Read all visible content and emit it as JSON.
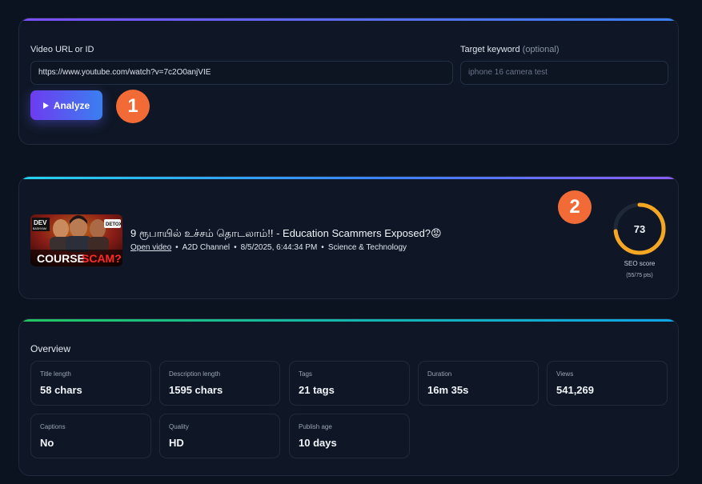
{
  "analyze_form": {
    "video_label": "Video URL or ID",
    "video_value": "https://www.youtube.com/watch?v=7c2O0anjVIE",
    "keyword_label": "Target keyword",
    "keyword_optional": "(optional)",
    "keyword_placeholder": "iphone 16 camera test",
    "analyze_button": "Analyze"
  },
  "markers": {
    "one": "1",
    "two": "2"
  },
  "video": {
    "title": "9 ரூபாயில் உச்சம் தொடலாம்!! - Education Scammers Exposed?😡",
    "open_link": "Open video",
    "channel": "A2D Channel",
    "published": "8/5/2025, 6:44:34 PM",
    "category": "Science & Technology",
    "separator": "•",
    "thumbnail_text": {
      "badge_left_top": "DEV",
      "badge_left_bottom": "BASHYAM",
      "badge_right": "DETOX",
      "caption_white": "COURSE",
      "caption_red": "SCAM?"
    },
    "seo": {
      "score": "73",
      "label": "SEO score",
      "points": "(55/75 pts)",
      "fraction": 0.733
    }
  },
  "overview": {
    "title": "Overview",
    "stats": [
      {
        "label": "Title length",
        "value": "58 chars"
      },
      {
        "label": "Description length",
        "value": "1595 chars"
      },
      {
        "label": "Tags",
        "value": "21 tags"
      },
      {
        "label": "Duration",
        "value": "16m 35s"
      },
      {
        "label": "Views",
        "value": "541,269"
      },
      {
        "label": "Captions",
        "value": "No"
      },
      {
        "label": "Quality",
        "value": "HD"
      },
      {
        "label": "Publish age",
        "value": "10 days"
      }
    ]
  },
  "colors": {
    "background": "#0b1320",
    "card": "#0f1726",
    "marker": "#f26a35",
    "score_ring": "#f5a623",
    "button_gradient_start": "#6d3cf0",
    "button_gradient_end": "#3b7ff0"
  }
}
